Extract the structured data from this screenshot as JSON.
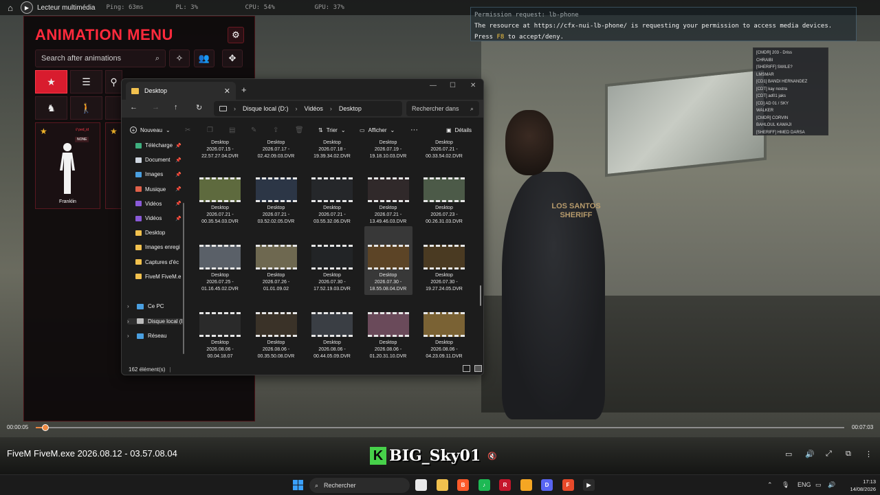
{
  "topbar": {
    "player_title": "Lecteur multimédia",
    "stats": [
      "Ping: 63ms",
      "PL: 3%",
      "CPU: 54%",
      "GPU: 37%"
    ]
  },
  "animation_menu": {
    "title": "ANIMATION MENU",
    "search_placeholder": "Search after animations",
    "card": {
      "ped_tag": "// ped_id",
      "tag": "NONE",
      "name": "Franklin"
    }
  },
  "permission": {
    "title": "Permission request: lb-phone",
    "message": "The resource at https://cfx-nui-lb-phone/ is requesting your permission to access media devices.",
    "press": "Press",
    "key": "F8",
    "action": "to accept/deny."
  },
  "player_list": [
    "[CMDR] 203 - Driss",
    "CHRAIBI",
    "[SHERIFF] SWILE?",
    "LMSMAR",
    "[CD1] BANDI HERNANDEZ",
    "[CDT] kay nostra",
    "[CDT] ad01 jaks",
    "[CD] AD 01 / SKY",
    "WALKER",
    "[CMDR] CORVIN",
    "BAHLOUL KAWAJI",
    "[SHERIFF] HMED DARSA"
  ],
  "explorer": {
    "tab_title": "Desktop",
    "breadcrumb": [
      "Disque local (D:)",
      "Vidéos",
      "Desktop"
    ],
    "search_placeholder": "Rechercher dans",
    "commands": {
      "new": "Nouveau",
      "sort": "Trier",
      "view": "Afficher",
      "details": "Détails"
    },
    "sidebar": [
      {
        "label": "Télécharge",
        "color": "#3fb07f",
        "pinned": true
      },
      {
        "label": "Document",
        "color": "#cfd6e0",
        "pinned": true
      },
      {
        "label": "Images",
        "color": "#4a9fe0",
        "pinned": true
      },
      {
        "label": "Musique",
        "color": "#e0614a",
        "pinned": true
      },
      {
        "label": "Vidéos",
        "color": "#8a5ad8",
        "pinned": true
      },
      {
        "label": "Vidéos",
        "color": "#8a5ad8",
        "pinned": true
      },
      {
        "label": "Desktop",
        "color": "#f2c14e",
        "pinned": false
      },
      {
        "label": "Images enregi",
        "color": "#f2c14e",
        "pinned": false
      },
      {
        "label": "Captures d'éc",
        "color": "#f2c14e",
        "pinned": false
      },
      {
        "label": "FiveM FiveM.e",
        "color": "#f2c14e",
        "pinned": false
      }
    ],
    "tree": [
      {
        "label": "Ce PC",
        "color": "#4a9fe0"
      },
      {
        "label": "Disque local (I",
        "color": "#bbbbbb"
      },
      {
        "label": "Réseau",
        "color": "#4a9fe0"
      }
    ],
    "files": [
      {
        "name": "Desktop",
        "line1": "2026.07.15 -",
        "line2": "22.57.27.04.DVR",
        "thumb": ""
      },
      {
        "name": "Desktop",
        "line1": "2026.07.17 -",
        "line2": "02.42.09.03.DVR",
        "thumb": ""
      },
      {
        "name": "Desktop",
        "line1": "2026.07.18 -",
        "line2": "19.39.34.02.DVR",
        "thumb": ""
      },
      {
        "name": "Desktop",
        "line1": "2026.07.19 -",
        "line2": "19.18.10.03.DVR",
        "thumb": ""
      },
      {
        "name": "Desktop",
        "line1": "2026.07.21 -",
        "line2": "00.33.54.02.DVR",
        "thumb": ""
      },
      {
        "name": "Desktop",
        "line1": "2026.07.21 -",
        "line2": "00.35.54.03.DVR",
        "thumb": "#5e6a3e"
      },
      {
        "name": "Desktop",
        "line1": "2026.07.21 -",
        "line2": "03.52.02.05.DVR",
        "thumb": "#2c3646"
      },
      {
        "name": "Desktop",
        "line1": "2026.07.21 -",
        "line2": "03.55.32.06.DVR",
        "thumb": "#25272a"
      },
      {
        "name": "Desktop",
        "line1": "2026.07.21 -",
        "line2": "13.49.46.03.DVR",
        "thumb": "#30292a"
      },
      {
        "name": "Desktop",
        "line1": "2026.07.23 -",
        "line2": "00.26.31.03.DVR",
        "thumb": "#4c5a48"
      },
      {
        "name": "Desktop",
        "line1": "2026.07.25 -",
        "line2": "01.16.45.02.DVR",
        "thumb": "#5a6068"
      },
      {
        "name": "Desktop",
        "line1": "2026.07.26 -",
        "line2": "01.01.09.02",
        "thumb": "#6e6850"
      },
      {
        "name": "Desktop",
        "line1": "2026.07.30 -",
        "line2": "17.52.19.03.DVR",
        "thumb": "#222426"
      },
      {
        "name": "Desktop",
        "line1": "2026.07.30 -",
        "line2": "18.55.08.04.DVR",
        "thumb": "#5c4426"
      },
      {
        "name": "Desktop",
        "line1": "2026.07.30 -",
        "line2": "19.27.24.05.DVR",
        "thumb": "#4a3a22"
      },
      {
        "name": "Desktop",
        "line1": "2026.08.06 -",
        "line2": "00.04.18.07",
        "thumb": "#2a2a2a"
      },
      {
        "name": "Desktop",
        "line1": "2026.08.06 -",
        "line2": "00.35.50.08.DVR",
        "thumb": "#3a3228"
      },
      {
        "name": "Desktop",
        "line1": "2026.08.06 -",
        "line2": "00.44.05.09.DVR",
        "thumb": "#3a3e44"
      },
      {
        "name": "Desktop",
        "line1": "2026.08.06 -",
        "line2": "01.20.31.10.DVR",
        "thumb": "#6a4a5a"
      },
      {
        "name": "Desktop",
        "line1": "2026.08.06 -",
        "line2": "04.23.09.11.DVR",
        "thumb": "#7a6234"
      }
    ],
    "selected_index": 13,
    "status": "162 élément(s)"
  },
  "player": {
    "time_current": "00:00:05",
    "time_total": "00:07:03",
    "progress": 0.012,
    "file_title": "FiveM FiveM.exe 2026.08.12 - 03.57.08.04",
    "watermark_letter": "K",
    "watermark": "BIG_Sky01"
  },
  "taskbar": {
    "search": "Rechercher",
    "apps": [
      {
        "icon": "file-explorer-icon",
        "color": "#e9e9e9",
        "glyph": ""
      },
      {
        "icon": "folder-icon",
        "color": "#f2c14e",
        "glyph": ""
      },
      {
        "icon": "brave-icon",
        "color": "#ff5a2a",
        "glyph": "B"
      },
      {
        "icon": "spotify-icon",
        "color": "#1db954",
        "glyph": "♪"
      },
      {
        "icon": "rockstar-icon",
        "color": "#c5162b",
        "glyph": "R"
      },
      {
        "icon": "app-icon",
        "color": "#f5a623",
        "glyph": ""
      },
      {
        "icon": "discord-icon",
        "color": "#5865f2",
        "glyph": "D"
      },
      {
        "icon": "fivem-icon",
        "color": "#e84a2a",
        "glyph": "F"
      },
      {
        "icon": "media-player-icon",
        "color": "#2b2b2b",
        "glyph": "▶"
      }
    ],
    "lang": "ENG",
    "time": "17:13",
    "date": "14/08/2026"
  }
}
